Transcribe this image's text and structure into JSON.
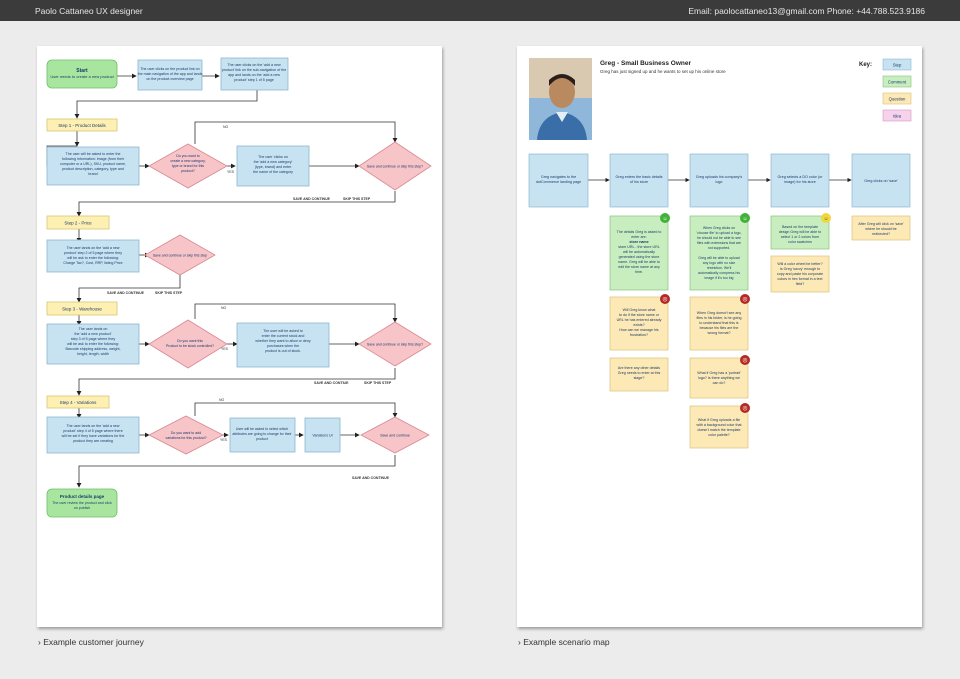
{
  "header": {
    "left_text": "Paolo Cattaneo UX designer",
    "right_text": "Email: paolocattaneo13@gmail.com Phone: +44.788.523.9186"
  },
  "captions": {
    "left": "› Example customer journey",
    "right": "› Example scenario map"
  },
  "journey": {
    "start_title": "Start",
    "start_sub": "User needs to create a new product",
    "box_a": [
      "The user clicks on the product link on",
      "the main navigation of the app and lands",
      "on the product overview page"
    ],
    "box_b": [
      "The user clicks on the 'add a new",
      "product' link on the sub-navigation of the",
      "app and lands on the 'add a new",
      "product' step 1 of 5 page"
    ],
    "step1": "Step 1 - Product Details",
    "step1_text": [
      "The user will be asked to enter the",
      "following information: image (from their",
      "computer or a URL), SKU, product name,",
      "product description, category, type and",
      "brand"
    ],
    "d1": [
      "Do you want to",
      "create a new category,",
      "type or brand for this",
      "product?"
    ],
    "d1_box": [
      "The user 'clicks on",
      "the 'add a new category'",
      "(type, brand) and enter",
      "the name of the category"
    ],
    "save_continue_skip": "Save and continue or skip this step?",
    "save_and_continue": "SAVE AND CONTINUE",
    "save_and_contiue": "SAVE AND CONTIUE",
    "skip_this_step": "SKIP THIS STEP",
    "yes": "YES",
    "no": "NO",
    "step2": "Step 2 - Price",
    "step2_text": [
      "The user lands on the 'add a new",
      "product' step 2 of 5 page where they",
      "will be ask to enter the following:",
      "Charge Tax?, Cost, RRP, listing Price"
    ],
    "save_continue_skip_2": "Save and continue or skip this step",
    "step3": "Step 3 - Warehouse",
    "step3_text": [
      "The user lands on",
      "the 'add a new product'",
      "step 3 of 5 page where they",
      "will be ask to enter the following:",
      "Barcode shipping address, weight,",
      "height, length, width"
    ],
    "d3": [
      "Do you want this",
      "Product to be stock controlled?"
    ],
    "d3_box": [
      "The user will be asked to",
      "enter the current stock and",
      "whether they want to allow or deny",
      "purchases when the",
      "product is out of stock."
    ],
    "step4": "Step 4 - Variations",
    "step4_text": [
      "The user lands on the 'add a new",
      "product' step 4 of 5 page where there",
      "will be set if they have variations for the",
      "product they are creating"
    ],
    "d4": [
      "Do you want to add",
      "variations for this product?"
    ],
    "d4_box": [
      "User will be asked to select which",
      "attributes are going to change for their",
      "product"
    ],
    "variations_ui": "Variations UI",
    "save_and_continue_small": "Save and continue",
    "end_title": "Product details page",
    "end_sub": [
      "The user review the product and click",
      "on publish"
    ]
  },
  "scenario": {
    "persona_name": "Greg - Small Business Owner",
    "persona_desc": "Greg has just signed up and he wants to set up his online store",
    "key_title": "Key:",
    "key_items": [
      "Step",
      "Comment",
      "Question",
      "Idea"
    ],
    "steps": [
      [
        "Greg navigates to the",
        "dotCommerce landing page"
      ],
      [
        "Greg enters the basic details",
        "of his store"
      ],
      [
        "Greg uploads his company's",
        "logo"
      ],
      [
        "Greg selects a DO color (or",
        "image) for his store"
      ],
      [
        "Greg clicks on 'save'"
      ]
    ],
    "c1": [
      "The details Greg is asked to",
      "enter are:",
      "store name",
      "store URL - the store URL",
      "will be automatically",
      "generated using the store",
      "name. Greg will be able to",
      "edit the store name at any",
      "time."
    ],
    "c2": [
      "When Greg clicks on",
      "'choose file' to upload a logo,",
      "he should not be able to see",
      "files with extensions that are",
      "not supported.",
      "",
      "Greg will be able to upload",
      "any logo with no size",
      "restriction. We'll",
      "automatically compress his",
      "image if it's too big"
    ],
    "c3": [
      "Based on the template",
      "design Greg will be able to",
      "select 1 or 2 colors from",
      "color swatches"
    ],
    "c4": [
      "After Greg will click on 'save'",
      "where he should be",
      "redirected?"
    ],
    "q1": [
      "Will Greg know what",
      "to do if the store name or",
      "URL he has entered already",
      "exists?",
      "How can we manage his",
      "frustration?"
    ],
    "q2": [
      "Are there any other details",
      "Greg needs to enter at this",
      "stage?"
    ],
    "q3": [
      "When Greg doesn't see any",
      "files in his folder, is he going",
      "to understand that this is",
      "because his files are the",
      "wrong format?"
    ],
    "q4": [
      "What if Greg has a 'portrait'",
      "logo? Is there anything we",
      "can do?"
    ],
    "q5": [
      "What if Greg uploads a file",
      "with a background color that",
      "doesn't match the template",
      "color palette?"
    ],
    "q6": [
      "Will a color wheel be better?",
      "Is Greg 'savvy' enough to",
      "copy and paste his corporate",
      "colors in hex format in a text",
      "field?"
    ]
  },
  "colors": {
    "step": "#c7e2f0",
    "comment": "#c8eec0",
    "question": "#fde9b5",
    "idea": "#f7d2ec",
    "decision": "#f7c4c8",
    "step_label": "#fdf0b2"
  }
}
